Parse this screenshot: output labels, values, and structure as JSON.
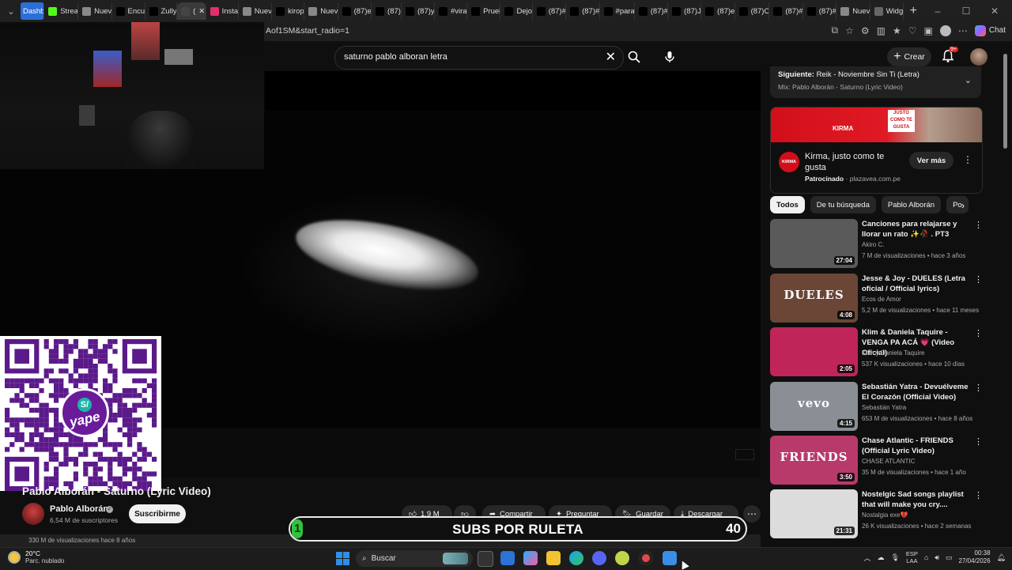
{
  "browser": {
    "tabs": [
      {
        "label": "Dashb",
        "icon": "dashboard-icon",
        "color": "#2b6fd6"
      },
      {
        "label": "Strea",
        "icon": "kick-icon",
        "color": "#53fc18"
      },
      {
        "label": "Nuev",
        "icon": "page-icon",
        "color": "#888888"
      },
      {
        "label": "Encu",
        "icon": "tiktok-icon",
        "color": "#000000"
      },
      {
        "label": "Zully",
        "icon": "tiktok-icon",
        "color": "#000000"
      },
      {
        "label": "(",
        "icon": "speaker-icon",
        "color": "#444444",
        "active": true
      },
      {
        "label": "Insta",
        "icon": "instagram-icon",
        "color": "#e1306c"
      },
      {
        "label": "Nuev",
        "icon": "page-icon",
        "color": "#888888"
      },
      {
        "label": "kirop",
        "icon": "tiktok-icon",
        "color": "#000000"
      },
      {
        "label": "Nuev",
        "icon": "page-icon",
        "color": "#888888"
      },
      {
        "label": "(87)e",
        "icon": "tiktok-icon",
        "color": "#000000"
      },
      {
        "label": "(87)",
        "icon": "tiktok-icon",
        "color": "#000000"
      },
      {
        "label": "(87)y",
        "icon": "tiktok-icon",
        "color": "#000000"
      },
      {
        "label": "#vira",
        "icon": "tiktok-icon",
        "color": "#000000"
      },
      {
        "label": "Prueł",
        "icon": "tiktok-icon",
        "color": "#000000"
      },
      {
        "label": "Dejo",
        "icon": "tiktok-icon",
        "color": "#000000"
      },
      {
        "label": "(87)#",
        "icon": "tiktok-icon",
        "color": "#000000"
      },
      {
        "label": "(87)#",
        "icon": "tiktok-icon",
        "color": "#000000"
      },
      {
        "label": "#para",
        "icon": "tiktok-icon",
        "color": "#000000"
      },
      {
        "label": "(87)#",
        "icon": "tiktok-icon",
        "color": "#000000"
      },
      {
        "label": "(87)J",
        "icon": "tiktok-icon",
        "color": "#000000"
      },
      {
        "label": "(87)e",
        "icon": "tiktok-icon",
        "color": "#000000"
      },
      {
        "label": "(87)C",
        "icon": "tiktok-icon",
        "color": "#000000"
      },
      {
        "label": "(87)#",
        "icon": "tiktok-icon",
        "color": "#000000"
      },
      {
        "label": "(87)#",
        "icon": "tiktok-icon",
        "color": "#000000"
      },
      {
        "label": "Nuev",
        "icon": "page-icon",
        "color": "#888888"
      },
      {
        "label": "Widg",
        "icon": "widget-icon",
        "color": "#666666"
      }
    ],
    "new_tab": "+",
    "url": "Aof1SM&start_radio=1",
    "chat_label": "Chat"
  },
  "youtube": {
    "search_value": "saturno pablo alboran letra",
    "create_label": "Crear",
    "notif_count": "9+",
    "video": {
      "title": "Pablo Alborán - Saturno (Lyric Video)",
      "channel": "Pablo Alborán",
      "subscribers": "6,54 M de suscriptores",
      "subscribe_label": "Suscribirme",
      "likes": "1,9 M",
      "share": "Compartir",
      "ask": "Preguntar",
      "save": "Guardar",
      "download": "Descargar",
      "desc_preview": "330 M de visualizaciones  hace 8 años"
    },
    "up_next": {
      "label": "Siguiente:",
      "title": "Reik - Noviembre Sin Ti (Letra)",
      "mix": "Mix: Pablo Alborán - Saturno (Lyric Video)"
    },
    "ad": {
      "title": "Kirma, justo como te gusta",
      "sponsored": "Patrocinado",
      "domain": "plazavea.com.pe",
      "button": "Ver más",
      "brand": "KIRMA",
      "tagline": "JUSTO COMO TE GUSTA"
    },
    "chips": [
      "Todos",
      "De tu búsqueda",
      "Pablo Alborán",
      "Po"
    ],
    "recommendations": [
      {
        "title": "Canciones para relajarse y llorar un rato ✨🥀 . PT3",
        "channel": "Akiro C.",
        "meta": "7 M de visualizaciones • hace 3 años",
        "duration": "27:04",
        "thumb_color": "#5a5a5a"
      },
      {
        "title": "Jesse & Joy - DUELES (Letra oficial / Official lyrics)",
        "channel": "Ecos de Amor",
        "meta": "5,2 M de visualizaciones • hace 11 meses",
        "duration": "4:08",
        "thumb_color": "#6b4636",
        "thumb_text": "DUELES"
      },
      {
        "title": "Klim & Daniela Taquire - VENGA PA ACÁ 💗 (Video Oficial)",
        "channel": "Klim y Daniela Taquire",
        "meta": "537 K visualizaciones • hace 10 días",
        "duration": "2:05",
        "thumb_color": "#c0255a"
      },
      {
        "title": "Sebastián Yatra - Devuélveme El Corazón (Official Video)",
        "channel": "Sebastián Yatra",
        "meta": "653 M de visualizaciones • hace 8 años",
        "duration": "4:15",
        "thumb_color": "#8a8f96",
        "thumb_text": "vevo"
      },
      {
        "title": "Chase Atlantic - FRIENDS (Official Lyric Video)",
        "channel": "CHASE ATLANTIC",
        "meta": "35 M de visualizaciones • hace 1 año",
        "duration": "3:50",
        "thumb_color": "#b83a6a",
        "thumb_text": "FRIENDS"
      },
      {
        "title": "Nostelgic Sad songs playlist that will make you cry....",
        "channel": "Nostalgia exe💔",
        "meta": "26 K visualizaciones • hace 2 semanas",
        "duration": "21:31",
        "thumb_color": "#dcdcdc"
      }
    ]
  },
  "overlay": {
    "subs_label": "SUBS POR RULETA",
    "subs_start": "1",
    "subs_goal": "40",
    "subs_progress": 0.025,
    "qr_brand": "yape",
    "qr_symbol": "S/"
  },
  "taskbar": {
    "temp": "20°C",
    "weather": "Parc. nublado",
    "search_label": "Buscar",
    "lang_line1": "ESP",
    "lang_line2": "LAA",
    "time": "00:38",
    "date": "27/04/2026"
  }
}
